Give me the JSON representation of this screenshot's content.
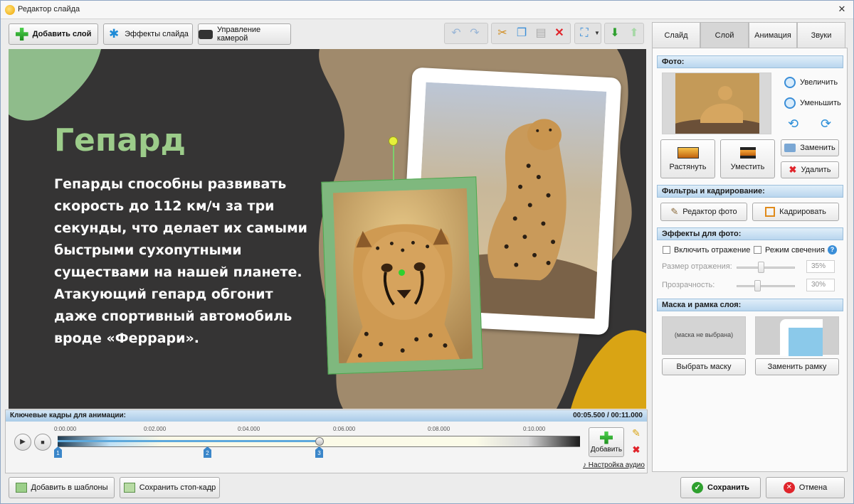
{
  "window": {
    "title": "Редактор слайда"
  },
  "toolbar": {
    "add_layer": "Добавить слой",
    "slide_effects": "Эффекты слайда",
    "camera_control": "Управление камерой"
  },
  "tabs": [
    "Слайд",
    "Слой",
    "Анимация",
    "Звуки"
  ],
  "slide": {
    "title": "Гепард",
    "body": "Гепарды способны развивать скорость до 112 км/ч за три секунды, что делает их самыми быстрыми сухопутными существами на нашей планете. Атакующий гепард обгонит даже спортивный автомобиль вроде «Феррари»."
  },
  "panel": {
    "photo_header": "Фото:",
    "zoom_in": "Увеличить",
    "zoom_out": "Уменьшить",
    "stretch": "Растянуть",
    "fit": "Уместить",
    "replace": "Заменить",
    "delete": "Удалить",
    "filters_header": "Фильтры и кадрирование:",
    "photo_editor": "Редактор фото",
    "crop": "Кадрировать",
    "effects_header": "Эффекты для фото:",
    "reflection": "Включить отражение",
    "glow": "Режим свечения",
    "reflection_size_label": "Размер отражения:",
    "reflection_size_value": "35%",
    "transparency_label": "Прозрачность:",
    "transparency_value": "30%",
    "mask_header": "Маска и рамка слоя:",
    "mask_placeholder": "(маска не выбрана)",
    "choose_mask": "Выбрать маску",
    "replace_frame": "Заменить рамку"
  },
  "timeline": {
    "header": "Ключевые кадры для анимации:",
    "time": "00:05.500 / 00:11.000",
    "ticks": [
      "0:00.000",
      "0:02.000",
      "0:04.000",
      "0:06.000",
      "0:08.000",
      "0:10.000"
    ],
    "keyframes": [
      "1",
      "2",
      "3"
    ],
    "add": "Добавить",
    "audio_settings": "Настройка аудио"
  },
  "footer": {
    "add_to_templates": "Добавить в шаблоны",
    "save_still": "Сохранить стоп-кадр",
    "save": "Сохранить",
    "cancel": "Отмена"
  }
}
